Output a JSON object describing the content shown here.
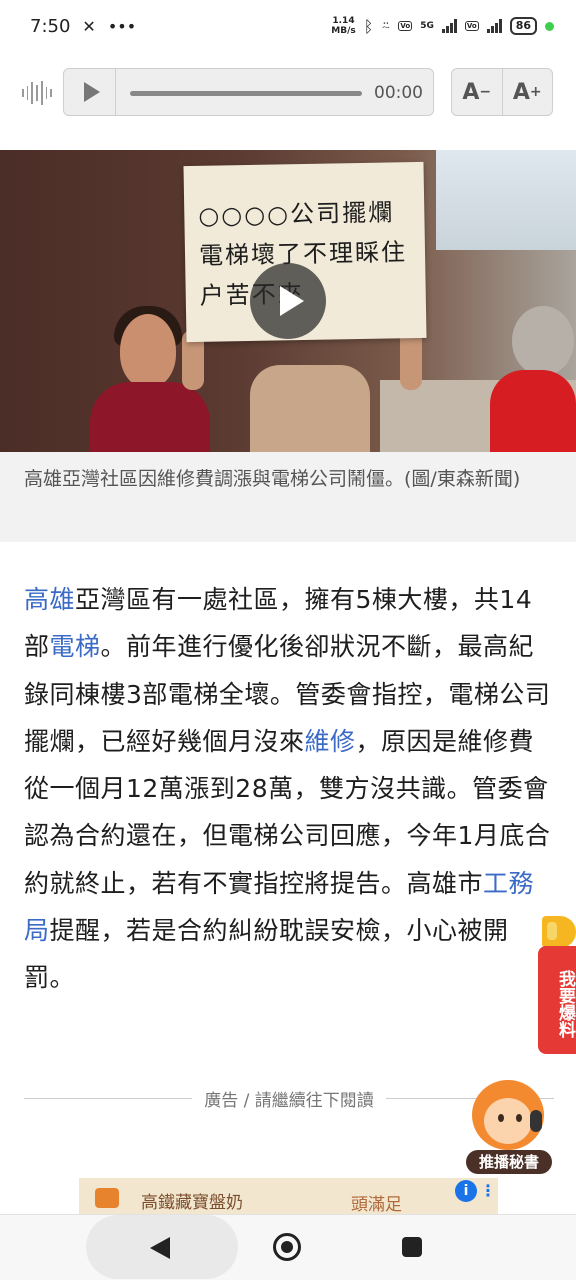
{
  "status_bar": {
    "time": "7:50",
    "speed_value": "1.14",
    "speed_unit": "MB/s",
    "network_5g": "5G",
    "battery": "86"
  },
  "audio_player": {
    "time": "00:00",
    "font_decrease": "A",
    "font_increase": "A",
    "font_decrease_sign": "−",
    "font_increase_sign": "+"
  },
  "hero_image": {
    "sign_text": "○○○○公司擺爛電梯壞了不理睬住户苦不來"
  },
  "caption": "高雄亞灣社區因維修費調漲與電梯公司鬧僵。(圖/東森新聞)",
  "article": {
    "segments": [
      {
        "text": "高雄",
        "link": true
      },
      {
        "text": "亞灣區有一處社區，擁有5棟大樓，共14部",
        "link": false
      },
      {
        "text": "電梯",
        "link": true
      },
      {
        "text": "。前年進行優化後卻狀況不斷，最高紀錄同棟樓3部電梯全壞。管委會指控，電梯公司擺爛，已經好幾個月沒來",
        "link": false
      },
      {
        "text": "維修",
        "link": true
      },
      {
        "text": "，原因是維修費從一個月12萬漲到28萬，雙方沒共識。管委會認為合約還在，但電梯公司回應，今年1月底合約就終止，若有不實指控將提告。高雄市",
        "link": false
      },
      {
        "text": "工務局",
        "link": true
      },
      {
        "text": "提醒，若是合約糾紛耽誤安檢，小心被開罰。",
        "link": false
      }
    ]
  },
  "ad_divider": "廣告 / 請繼續往下閱讀",
  "ad_banner": {
    "text1": "高鐵藏寶盤奶",
    "text2": "頭滿足"
  },
  "report_tab": "我要爆料",
  "assistant_label": "推播秘書",
  "colors": {
    "link": "#3b6bc6",
    "report_red": "#e53935"
  }
}
